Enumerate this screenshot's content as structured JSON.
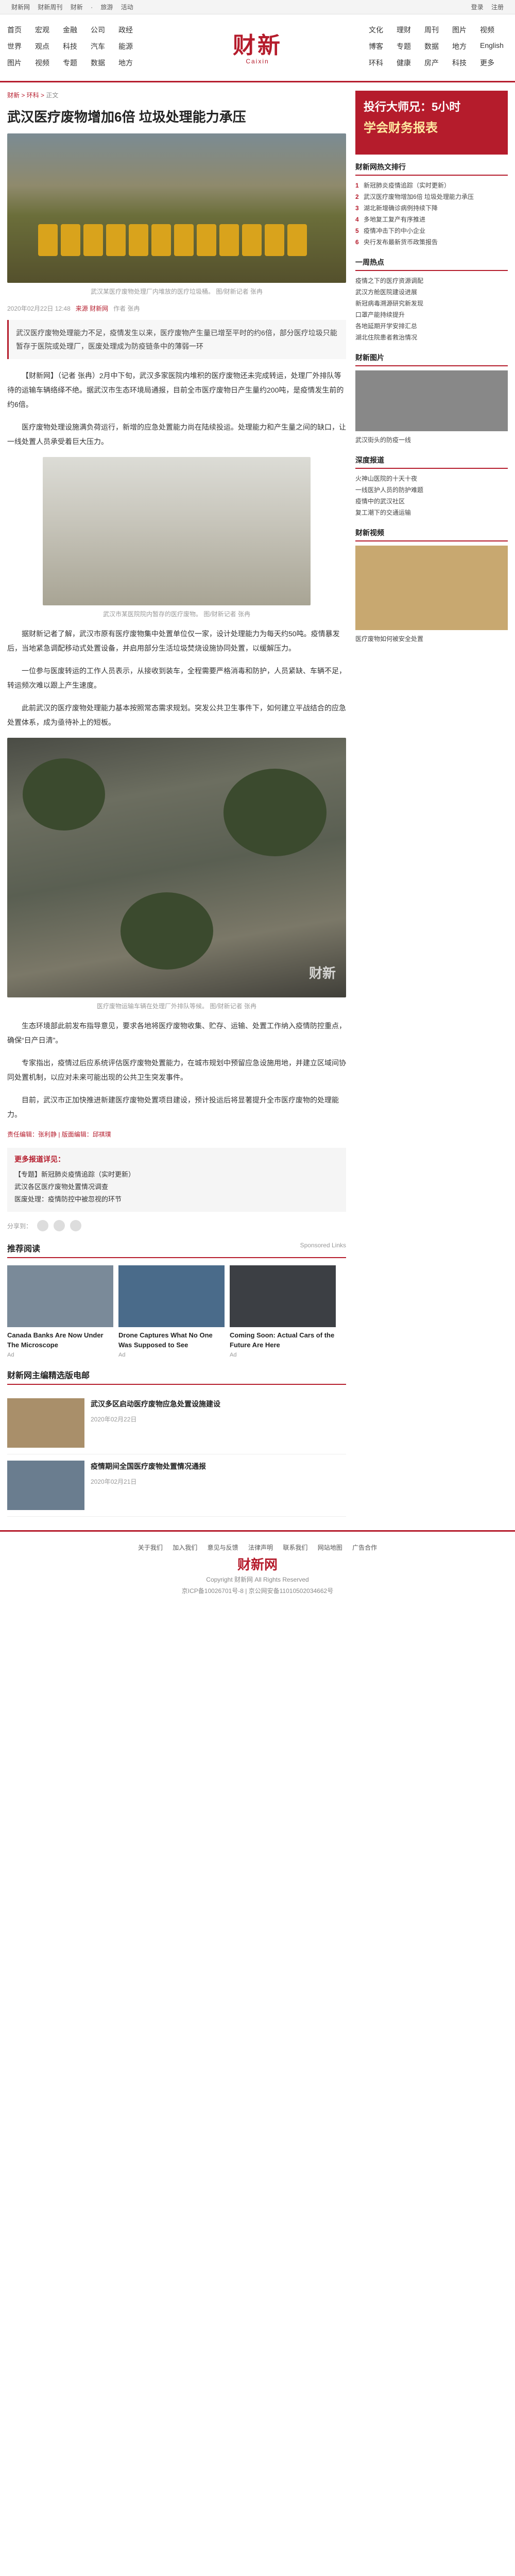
{
  "topbar": {
    "left": [
      "新闻 > ",
      "财新网",
      "财新周刊",
      "财新",
      "数据",
      "·",
      "旅游",
      "活动",
      "Caixin"
    ],
    "right": [
      "登录",
      "注册"
    ]
  },
  "nav_left": [
    "首页",
    "宏观",
    "金融",
    "公司",
    "政经",
    "世界",
    "观点",
    "科技",
    "汽车",
    "能源",
    "图片",
    "视频",
    "专题",
    "数据",
    "地方"
  ],
  "nav_right": [
    "文化",
    "理财",
    "周刊",
    "图片",
    "视频",
    "博客",
    "专题",
    "数据",
    "地方",
    "English",
    "环科",
    "健康",
    "房产",
    "科技",
    "更多"
  ],
  "logo": {
    "cn": "财新",
    "en": "Caixin"
  },
  "breadcrumb": {
    "a": "财新 > ",
    "b": "环科 > ",
    "c": "正文"
  },
  "article": {
    "title": "武汉医疗废物增加6倍 垃圾处理能力承压",
    "photo1_caption": "武汉某医疗废物处理厂内堆放的医疗垃圾桶。 图/财新记者 张冉",
    "meta_date": "2020年02月22日 12:48",
    "meta_source": "来源 财新网",
    "meta_author": "作者 张冉",
    "lead": "武汉医疗废物处理能力不足，疫情发生以来，医疗废物产生量已增至平时的约6倍，部分医疗垃圾只能暂存于医院或处理厂，医废处理成为防疫链条中的薄弱一环",
    "p1": "【财新网】（记者 张冉）2月中下旬，武汉多家医院内堆积的医疗废物还未完成转运，处理厂外排队等待的运输车辆络绎不绝。据武汉市生态环境局通报，目前全市医疗废物日产生量约200吨，是疫情发生前的约6倍。",
    "p2": "医疗废物处理设施满负荷运行，新增的应急处置能力尚在陆续投运。处理能力和产生量之间的缺口，让一线处置人员承受着巨大压力。",
    "photo2_caption": "武汉市某医院院内暂存的医疗废物。 图/财新记者 张冉",
    "p3": "据财新记者了解，武汉市原有医疗废物集中处置单位仅一家，设计处理能力为每天约50吨。疫情暴发后，当地紧急调配移动式处置设备，并启用部分生活垃圾焚烧设施协同处置，以缓解压力。",
    "p4": "一位参与医废转运的工作人员表示，从接收到装车，全程需要严格消毒和防护，人员紧缺、车辆不足，转运频次难以跟上产生速度。",
    "p5": "此前武汉的医疗废物处理能力基本按照常态需求规划。突发公共卫生事件下，如何建立平战结合的应急处置体系，成为亟待补上的短板。",
    "photo3_caption": "医疗废物运输车辆在处理厂外排队等候。 图/财新记者 张冉",
    "p6": "生态环境部此前发布指导意见，要求各地将医疗废物收集、贮存、运输、处置工作纳入疫情防控重点，确保“日产日清”。",
    "p7": "专家指出，疫情过后应系统评估医疗废物处置能力，在城市规划中预留应急设施用地，并建立区域间协同处置机制，以应对未来可能出现的公共卫生突发事件。",
    "p8": "目前，武汉市正加快推进新建医疗废物处置项目建设，预计投运后将显著提升全市医疗废物的处理能力。",
    "ai_note": "责任编辑：张利静 | 版面编辑：邱祺璞",
    "more_title": "更多报道详见：",
    "more_items": [
      "【专题】新冠肺炎疫情追踪（实时更新）",
      "武汉各区医疗废物处置情况调查",
      "医废处理：疫情防控中被忽视的环节"
    ],
    "share_label": "分享到："
  },
  "related": {
    "title": "推荐阅读",
    "sponsor": "Sponsored Links",
    "cards": [
      {
        "t": "Canada Banks Are Now Under The Microscope",
        "s": "Ad"
      },
      {
        "t": "Drone Captures What No One Was Supposed to See",
        "s": "Ad"
      },
      {
        "t": "Coming Soon: Actual Cars of the Future Are Here",
        "s": "Ad"
      }
    ]
  },
  "latest": {
    "title": "财新网主编精选版电邮",
    "rows": [
      {
        "t": "武汉多区启动医疗废物应急处置设施建设",
        "d": "2020年02月22日"
      },
      {
        "t": "疫情期间全国医疗废物处置情况通报",
        "d": "2020年02月21日"
      }
    ]
  },
  "sidebar": {
    "ad_line1": "投行大师兄：5小时",
    "ad_line2": "学会财务报表",
    "hot_title": "财新网热文排行",
    "hot": [
      "新冠肺炎疫情追踪（实时更新）",
      "武汉医疗废物增加6倍 垃圾处理能力承压",
      "湖北新增确诊病例持续下降",
      "多地复工复产有序推进",
      "疫情冲击下的中小企业",
      "央行发布最新货币政策报告"
    ],
    "week_title": "一周热点",
    "week": [
      "疫情之下的医疗资源调配",
      "武汉方舱医院建设进展",
      "新冠病毒溯源研究新发现",
      "口罩产能持续提升",
      "各地延期开学安排汇总",
      "湖北住院患者救治情况"
    ],
    "pic_title": "财新图片",
    "pic_caption": "武汉街头的防疫一线",
    "more_title": "深度报道",
    "more": [
      "火神山医院的十天十夜",
      "一线医护人员的防护难题",
      "疫情中的武汉社区",
      "复工潮下的交通运输"
    ],
    "video_title": "财新视频",
    "video_caption": "医疗废物如何被安全处置"
  },
  "footer": {
    "links": [
      "关于我们",
      "加入我们",
      "意见与反馈",
      "法律声明",
      "联系我们",
      "网站地图",
      "广告合作"
    ],
    "logo": "财新网",
    "copyright": "Copyright 财新网 All Rights Reserved",
    "icp": "京ICP备10026701号-8 | 京公网安备11010502034662号"
  },
  "colors": {
    "brand": "#b51c2c"
  }
}
